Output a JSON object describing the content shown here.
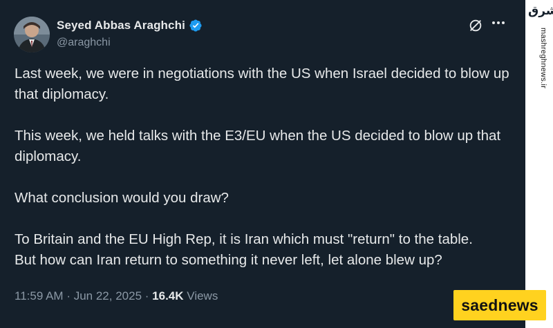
{
  "author": {
    "display_name": "Seyed Abbas Araghchi",
    "handle": "@araghchi",
    "verified": true
  },
  "icons": {
    "avatar": "profile-photo",
    "verified": "verified-badge-icon",
    "grok": "grok-icon",
    "more": "more-options-icon"
  },
  "tweet": {
    "paragraphs": [
      "Last week, we were in negotiations with the US when Israel decided to blow up that diplomacy.",
      "This week, we held talks with the E3/EU when the US decided to blow up that diplomacy.",
      "What conclusion would you draw?",
      "To Britain and the EU High Rep, it is Iran which must \"return\" to the table.\nBut how can Iran return to something it never left, let alone blew up?"
    ],
    "time": "11:59 AM",
    "separator": "·",
    "date": "Jun 22, 2025",
    "views_count": "16.4K",
    "views_label": "Views"
  },
  "watermarks": {
    "side_logo": "مشرق",
    "side_domain": "mashreghnews.ir",
    "badge": "saednews"
  },
  "colors": {
    "background": "#15202b",
    "text": "#e7e9ea",
    "secondary_text": "#8b98a5",
    "verified_blue": "#1d9bf0",
    "badge_yellow": "#ffd21f"
  }
}
